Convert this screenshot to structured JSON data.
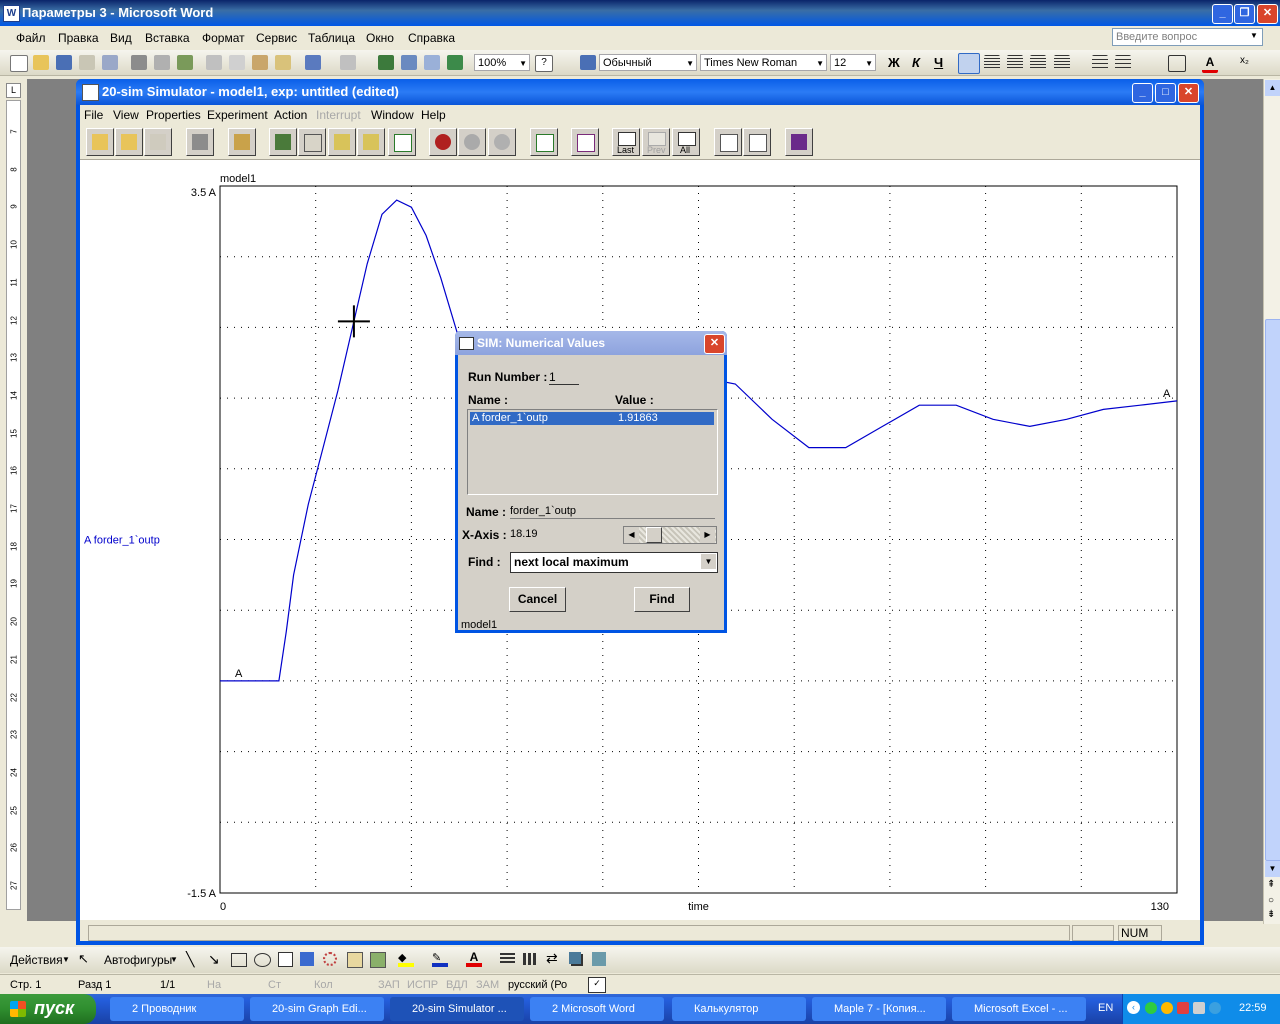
{
  "word": {
    "title": "Параметры 3 - Microsoft Word",
    "menu": [
      "Файл",
      "Правка",
      "Вид",
      "Вставка",
      "Формат",
      "Сервис",
      "Таблица",
      "Окно",
      "Справка"
    ],
    "ask_placeholder": "Введите вопрос",
    "zoom": "100%",
    "style": "Обычный",
    "font": "Times New Roman",
    "size": "12",
    "bold": "Ж",
    "italic": "К",
    "underline": "Ч",
    "ruler_numbers": [
      "7",
      "8",
      "9",
      "10",
      "11",
      "12",
      "13",
      "14",
      "15",
      "16",
      "17",
      "18",
      "19",
      "20",
      "21",
      "22",
      "23",
      "24",
      "25",
      "26",
      "27"
    ]
  },
  "sim": {
    "title": "20-sim  Simulator - model1, exp: untitled (edited)",
    "menu": [
      "File",
      "View",
      "Properties",
      "Experiment",
      "Action",
      "Interrupt",
      "Window",
      "Help"
    ],
    "toolbar_labels": {
      "last": "Last",
      "prev": "Prev",
      "all": "All"
    }
  },
  "chart_data": {
    "type": "line",
    "title": "model1",
    "xlabel": "time",
    "ylabel": "A forder_1`outp",
    "xlim": [
      0,
      130
    ],
    "ylim": [
      -1.5,
      3.5
    ],
    "tick_labels": {
      "x_min": "0",
      "x_max": "130",
      "y_min": "-1.5 A",
      "y_max": "3.5 A"
    },
    "grid": true,
    "series": [
      {
        "name": "A forder_1`outp",
        "label": "A",
        "color": "#0000CC",
        "x": [
          0,
          8,
          9,
          10,
          12,
          14,
          16,
          18,
          20,
          22,
          24,
          26,
          28,
          30,
          32,
          34,
          36,
          38,
          40,
          42,
          44,
          46,
          48,
          50,
          55,
          60,
          65,
          70,
          75,
          80,
          85,
          90,
          95,
          100,
          105,
          110,
          115,
          120,
          125,
          130
        ],
        "y": [
          0,
          0,
          0.35,
          0.75,
          1.25,
          1.65,
          2.05,
          2.5,
          2.95,
          3.3,
          3.4,
          3.35,
          3.15,
          2.85,
          2.5,
          2.15,
          1.8,
          1.55,
          1.3,
          1.15,
          1.0,
          1.0,
          1.1,
          1.2,
          1.6,
          1.95,
          2.15,
          2.1,
          1.85,
          1.65,
          1.65,
          1.8,
          1.95,
          1.95,
          1.85,
          1.8,
          1.85,
          1.92,
          1.95,
          1.98
        ]
      }
    ],
    "legend": "left"
  },
  "dialog": {
    "title": "SIM: Numerical Values",
    "run_label": "Run Number :",
    "run_value": "1",
    "name_header": "Name :",
    "value_header": "Value :",
    "row_name": "A forder_1`outp",
    "row_value": "1.91863",
    "name_label": "Name :",
    "name_value": "forder_1`outp",
    "xaxis_label": "X-Axis :",
    "xaxis_value": "18.19",
    "find_label": "Find :",
    "find_value": "next local maximum",
    "cancel": "Cancel",
    "find": "Find",
    "footer": "model1"
  },
  "drawbar": {
    "actions": "Действия",
    "autoshapes": "Автофигуры"
  },
  "status": {
    "page": "Стр. 1",
    "section": "Разд 1",
    "pages": "1/1",
    "at": "На",
    "line": "Ст",
    "col": "Кол",
    "rec": "ЗАП",
    "trk": "ИСПР",
    "ext": "ВДЛ",
    "ovr": "ЗАМ",
    "lang": "русский (Ро",
    "num": "NUM"
  },
  "taskbar": {
    "start": "пуск",
    "tasks": [
      "2 Проводник",
      "20-sim  Graph Edi...",
      "20-sim  Simulator ...",
      "2 Microsoft Word",
      "Калькулятор",
      "Maple 7  - [Копия...",
      "Microsoft Excel - ..."
    ],
    "lang": "EN",
    "clock": "22:59"
  }
}
